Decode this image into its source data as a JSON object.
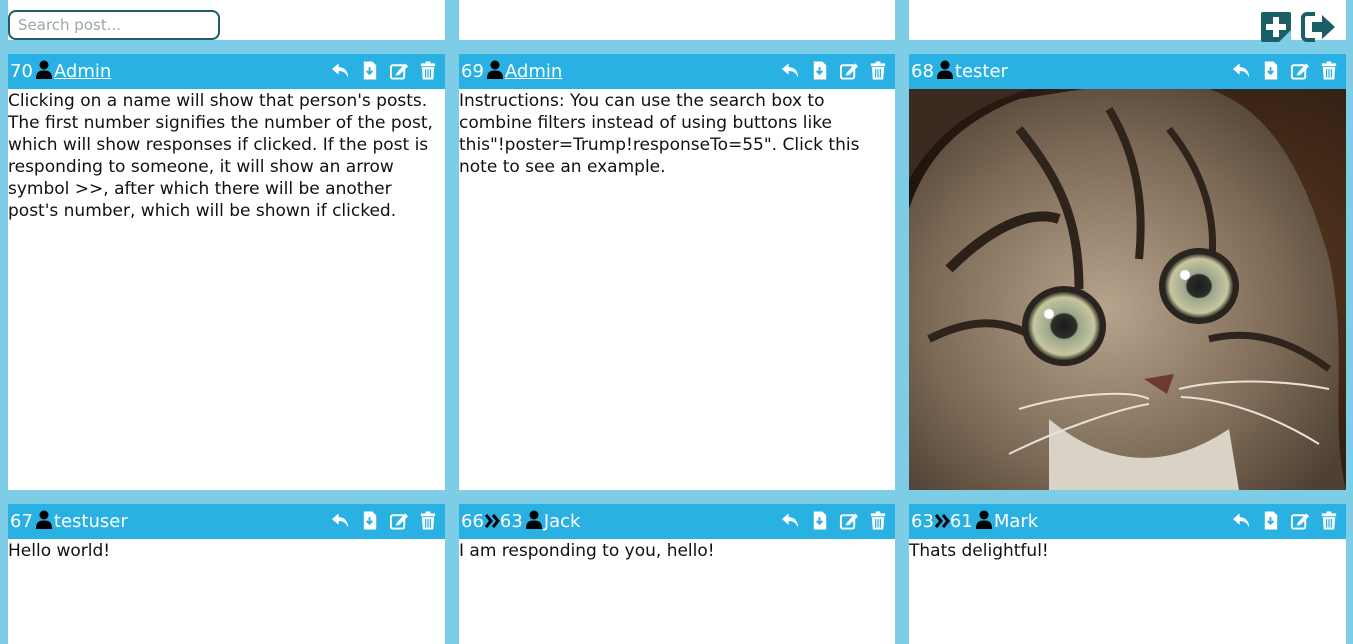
{
  "search": {
    "placeholder": "Search post..."
  },
  "toolbar": {
    "new_post_icon": "plus-square-icon",
    "logout_icon": "sign-out-icon"
  },
  "post_actions": [
    "reply-icon",
    "file-download-icon",
    "edit-icon",
    "trash-icon"
  ],
  "colors": {
    "background": "#7ecde6",
    "header": "#29b1e3",
    "border_search": "#1b5e63",
    "icon_dark": "#1b5e63"
  },
  "posts": [
    {
      "number": "70",
      "author": "Admin",
      "text": "Clicking on a name will show that person's posts. The first number signifies the number of the post, which will show responses if clicked. If the post is responding to someone, it will show an arrow symbol >>, after which there will be another post's number, which will be shown if clicked."
    },
    {
      "number": "69",
      "author": "Admin",
      "text": "Instructions: You can use the search box to combine filters instead of using buttons like this\"!poster=Trump!responseTo=55\". Click this note to see an example."
    },
    {
      "number": "68",
      "author": "tester",
      "image": "kitten-photo"
    },
    {
      "number": "67",
      "author": "testuser",
      "text": "Hello world!"
    },
    {
      "number": "66",
      "response_to": "63",
      "author": "Jack",
      "text": "I am responding to you, hello!"
    },
    {
      "number": "63",
      "response_to": "61",
      "author": "Mark",
      "text": "Thats delightful!"
    }
  ]
}
